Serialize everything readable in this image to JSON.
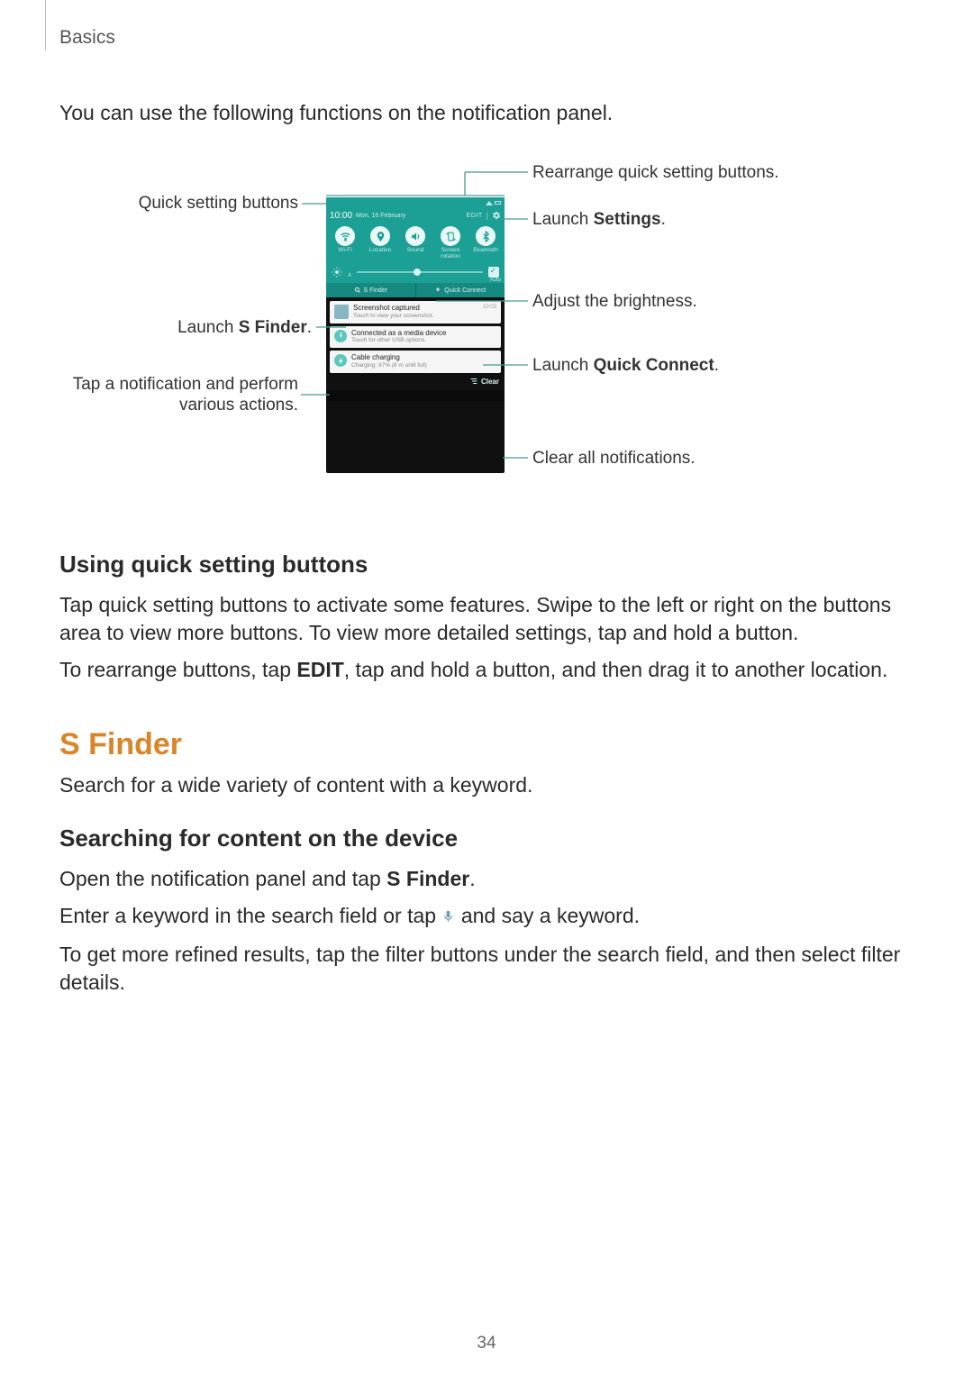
{
  "header": {
    "section": "Basics"
  },
  "intro": "You can use the following functions on the notification panel.",
  "page_number": "34",
  "callouts": {
    "quick_settings": "Quick setting buttons",
    "rearrange": "Rearrange quick setting buttons.",
    "launch_settings_pre": "Launch ",
    "launch_settings_bold": "Settings",
    "launch_settings_post": ".",
    "brightness": "Adjust the brightness.",
    "s_finder_pre": "Launch ",
    "s_finder_bold": "S Finder",
    "s_finder_post": ".",
    "quick_connect_pre": "Launch ",
    "quick_connect_bold": "Quick Connect",
    "quick_connect_post": ".",
    "notif_action": "Tap a notification and perform various actions.",
    "clear": "Clear all notifications."
  },
  "phone": {
    "time": "10:00",
    "date": "Mon, 16 February",
    "edit": "EDIT",
    "qbuttons": [
      {
        "label": "Wi-Fi",
        "icon": "wifi"
      },
      {
        "label": "Location",
        "icon": "location"
      },
      {
        "label": "Sound",
        "icon": "sound"
      },
      {
        "label": "Screen rotation",
        "icon": "rotate"
      },
      {
        "label": "Bluetooth",
        "icon": "bluetooth"
      }
    ],
    "brightness": {
      "auto_label": "Auto"
    },
    "twobtn": {
      "left": "S Finder",
      "right": "Quick Connect"
    },
    "notifications": [
      {
        "title": "Screenshot captured",
        "sub": "Touch to view your screenshot.",
        "time": "10:03",
        "type": "thumb"
      },
      {
        "title": "Connected as a media device",
        "sub": "Touch for other USB options.",
        "time": "",
        "type": "usb"
      },
      {
        "title": "Cable charging",
        "sub": "Charging: 97% (8 m until full)",
        "time": "",
        "type": "bolt"
      }
    ],
    "clear": "Clear"
  },
  "sections": {
    "using_qsb": {
      "heading": "Using quick setting buttons",
      "p1": "Tap quick setting buttons to activate some features. Swipe to the left or right on the buttons area to view more buttons. To view more detailed settings, tap and hold a button.",
      "p2_pre": "To rearrange buttons, tap ",
      "p2_bold": "EDIT",
      "p2_post": ", tap and hold a button, and then drag it to another location."
    },
    "sfinder": {
      "heading": "S Finder",
      "intro": "Search for a wide variety of content with a keyword.",
      "sub_heading": "Searching for content on the device",
      "p1_pre": "Open the notification panel and tap ",
      "p1_bold": "S Finder",
      "p1_post": ".",
      "p2_pre": "Enter a keyword in the search field or tap ",
      "p2_post": " and say a keyword.",
      "p3": "To get more refined results, tap the filter buttons under the search field, and then select filter details."
    }
  }
}
